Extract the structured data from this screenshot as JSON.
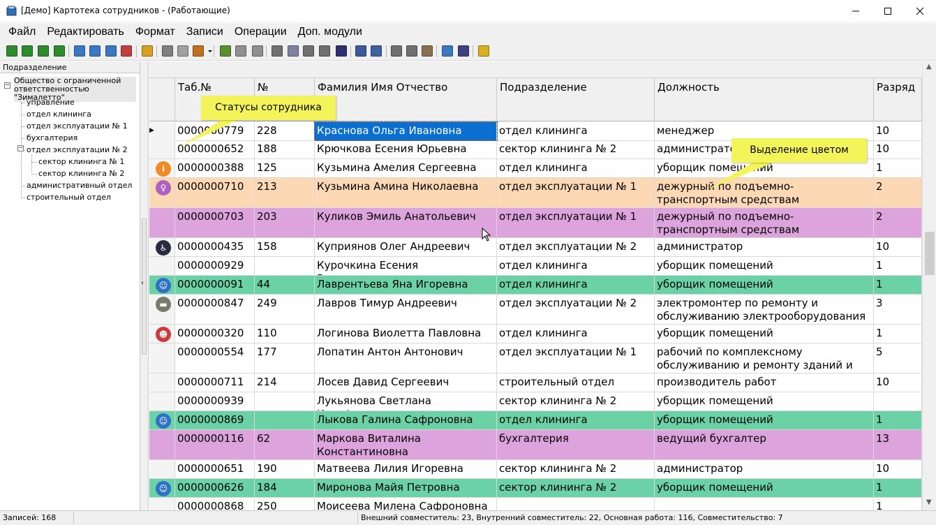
{
  "window": {
    "title": "[Демо]  Картотека сотрудников - (Работающие)",
    "minimize_icon": "minimize-icon",
    "maximize_icon": "maximize-icon",
    "close_icon": "close-icon"
  },
  "menu": [
    "Файл",
    "Редактировать",
    "Формат",
    "Записи",
    "Операции",
    "Доп. модули"
  ],
  "toolbar": {
    "icons": [
      "first-record-icon",
      "prev-record-icon",
      "next-record-icon",
      "last-record-icon",
      "add-record-icon",
      "copy-record-icon",
      "edit-record-icon",
      "delete-record-icon",
      "refresh-icon",
      "filter-icon",
      "filter-clear-icon",
      "search-icon",
      "dropdown-icon",
      "import-icon",
      "export-icon",
      "archive-icon",
      "columns-icon",
      "form-icon",
      "align-icon",
      "list-icon",
      "grid-icon",
      "layout-icon",
      "report-icon",
      "copy-icon",
      "cut-icon",
      "paste-icon",
      "preview-icon",
      "print-icon",
      "tools-icon"
    ]
  },
  "left_panel": {
    "header": "Подразделение",
    "tree": [
      {
        "label": "Общество с ограниченной ответственностью \"Зималетто\"",
        "level": 0
      },
      {
        "label": "управление",
        "level": 1
      },
      {
        "label": "отдел клининга",
        "level": 1
      },
      {
        "label": "отдел эксплуатации № 1",
        "level": 1
      },
      {
        "label": "бухгалтерия",
        "level": 1
      },
      {
        "label": "отдел эксплуатации № 2",
        "level": 1
      },
      {
        "label": "сектор клининга № 1",
        "level": 2
      },
      {
        "label": "сектор клининга № 2",
        "level": 2
      },
      {
        "label": "административный отдел",
        "level": 1
      },
      {
        "label": "строительный отдел",
        "level": 1
      }
    ]
  },
  "grid": {
    "columns": [
      "Таб.№",
      "№",
      "Фамилия Имя Отчество",
      "Подразделение",
      "Должность",
      "Разряд"
    ],
    "rows": [
      {
        "tab": "0000000779",
        "num": "228",
        "name": "Краснова Ольга Ивановна",
        "dept": "отдел клининга",
        "position": "менеджер",
        "grade": "10",
        "color": "",
        "icon": "",
        "selected": true
      },
      {
        "tab": "0000000652",
        "num": "188",
        "name": "Крючкова Есения Юрьевна",
        "dept": "сектор клининга № 2",
        "position": "администратор",
        "grade": "10",
        "color": "",
        "icon": ""
      },
      {
        "tab": "0000000388",
        "num": "125",
        "name": "Кузьмина Амелия Сергеевна",
        "dept": "отдел клининга",
        "position": "уборщик помещений",
        "grade": "1",
        "color": "",
        "icon": "info-icon"
      },
      {
        "tab": "0000000710",
        "num": "213",
        "name": "Кузьмина Амина Николаевна",
        "dept": "отдел эксплуатации № 1",
        "position": "дежурный по подъемно-транспортным средствам",
        "grade": "2",
        "color": "orange",
        "icon": "pregnant-icon"
      },
      {
        "tab": "0000000703",
        "num": "203",
        "name": "Куликов Эмиль Анатольевич",
        "dept": "отдел эксплуатации № 1",
        "position": "дежурный по подъемно-транспортным средствам",
        "grade": "2",
        "color": "purple",
        "icon": ""
      },
      {
        "tab": "0000000435",
        "num": "158",
        "name": "Куприянов Олег Андреевич",
        "dept": "отдел эксплуатации № 2",
        "position": "администратор",
        "grade": "10",
        "color": "",
        "icon": "wheelchair-icon"
      },
      {
        "tab": "0000000929",
        "num": "",
        "name": "Курочкина Есения Валентиновна",
        "dept": "отдел клининга",
        "position": "уборщик помещений",
        "grade": "1",
        "color": "",
        "icon": ""
      },
      {
        "tab": "0000000091",
        "num": "44",
        "name": "Лаврентьева Яна Игоревна",
        "dept": "отдел клининга",
        "position": "уборщик помещений",
        "grade": "1",
        "color": "green",
        "icon": "parent-child-icon"
      },
      {
        "tab": "0000000847",
        "num": "249",
        "name": "Лавров Тимур Андреевич",
        "dept": "отдел эксплуатации № 2",
        "position": "электромонтер по ремонту и обслуживанию электрооборудования",
        "grade": "3",
        "color": "",
        "icon": "military-icon"
      },
      {
        "tab": "0000000320",
        "num": "110",
        "name": "Логинова Виолетта Павловна",
        "dept": "отдел клининга",
        "position": "уборщик помещений",
        "grade": "1",
        "color": "",
        "icon": "family-icon"
      },
      {
        "tab": "0000000554",
        "num": "177",
        "name": "Лопатин Антон Антонович",
        "dept": "отдел эксплуатации № 1",
        "position": "рабочий по комплексному обслуживанию и ремонту зданий и сооружений",
        "grade": "5",
        "color": "",
        "icon": ""
      },
      {
        "tab": "0000000711",
        "num": "214",
        "name": "Лосев Давид Сергеевич",
        "dept": "строительный отдел",
        "position": "производитель работ",
        "grade": "10",
        "color": "",
        "icon": ""
      },
      {
        "tab": "0000000939",
        "num": "",
        "name": "Лукьянова Светлана Иосифовна",
        "dept": "сектор клининга № 2",
        "position": "уборщик помещений",
        "grade": "",
        "color": "",
        "icon": ""
      },
      {
        "tab": "0000000869",
        "num": "",
        "name": "Лыкова Галина Сафроновна",
        "dept": "отдел клининга",
        "position": "уборщик помещений",
        "grade": "1",
        "color": "green",
        "icon": "parent-child-icon"
      },
      {
        "tab": "0000000116",
        "num": "62",
        "name": "Маркова Виталина Константиновна",
        "dept": "бухгалтерия",
        "position": "ведущий бухгалтер",
        "grade": "13",
        "color": "purple",
        "icon": ""
      },
      {
        "tab": "0000000651",
        "num": "190",
        "name": "Матвеева Лилия Игоревна",
        "dept": "сектор клининга № 2",
        "position": "администратор",
        "grade": "10",
        "color": "",
        "icon": ""
      },
      {
        "tab": "0000000626",
        "num": "184",
        "name": "Миронова Майя Петровна",
        "dept": "сектор клининга № 2",
        "position": "уборщик помещений",
        "grade": "1",
        "color": "green",
        "icon": "parent-child-icon"
      },
      {
        "tab": "0000000868",
        "num": "250",
        "name": "Моисеева Милена Сафроновна",
        "dept": "",
        "position": "",
        "grade": "1",
        "color": "",
        "icon": ""
      }
    ]
  },
  "callouts": {
    "statuses": "Статусы сотрудника",
    "color_highlight": "Выделение цветом"
  },
  "status_bar": {
    "records": "Записей: 168",
    "summary": "Внешний совместитель: 23, Внутренний совместитель: 22, Основная работа: 116, Совместительство: 7"
  },
  "colors": {
    "orange": "#fdd8b5",
    "purple": "#dda3dd",
    "green": "#6ad2a6",
    "selection": "#0a6fd0",
    "callout": "#f3f35a"
  }
}
